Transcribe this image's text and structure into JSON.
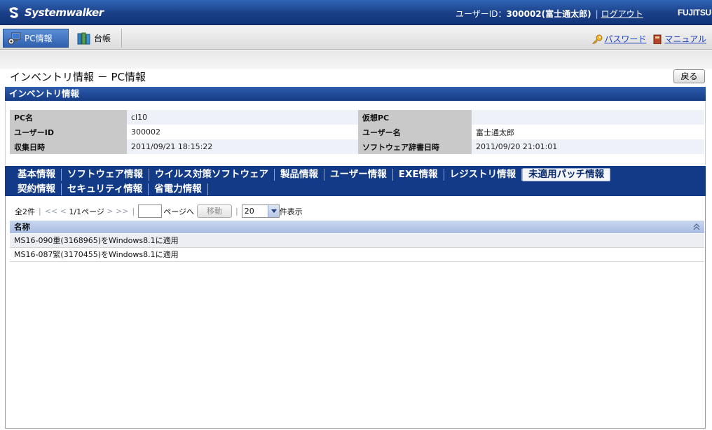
{
  "header": {
    "brand": "Systemwalker",
    "user_label": "ユーザーID：",
    "user_value": "300002(富士通太郎)",
    "separator": "|",
    "logout": "ログアウト",
    "company": "FUJITSU"
  },
  "toolbar": {
    "tabs": [
      {
        "label": "PC情報",
        "icon": "pc-icon",
        "active": true
      },
      {
        "label": "台帳",
        "icon": "ledger-books-icon",
        "active": false
      }
    ],
    "password": "パスワード",
    "manual": "マニュアル"
  },
  "page": {
    "title": "インベントリ情報 － PC情報",
    "back_button": "戻る"
  },
  "inventory": {
    "section_title": "インベントリ情報",
    "rows": [
      {
        "label1": "PC名",
        "value1": "cl10",
        "label2": "仮想PC",
        "value2": ""
      },
      {
        "label1": "ユーザーID",
        "value1": "300002",
        "label2": "ユーザー名",
        "value2": "富士通太郎"
      },
      {
        "label1": "収集日時",
        "value1": "2011/09/21 18:15:22",
        "label2": "ソフトウェア辞書日時",
        "value2": "2011/09/20 21:01:01"
      }
    ]
  },
  "tabs": {
    "row1": [
      "基本情報",
      "ソフトウェア情報",
      "ウイルス対策ソフトウェア",
      "製品情報",
      "ユーザー情報",
      "EXE情報",
      "レジストリ情報",
      "未適用パッチ情報"
    ],
    "row2": [
      "契約情報",
      "セキュリティ情報",
      "省電力情報"
    ],
    "active": "未適用パッチ情報"
  },
  "pager": {
    "total": "全2件",
    "first": "<<",
    "prev": "<",
    "page_info": "1/1ページ",
    "next": ">",
    "last": ">>",
    "page_input": "",
    "goto_label": "ページへ",
    "move_button": "移動",
    "page_size": "20",
    "page_size_suffix": "件表示"
  },
  "list": {
    "column": "名称",
    "items": [
      "MS16-090重(3168965)をWindows8.1に適用",
      "MS16-087緊(3170455)をWindows8.1に適用"
    ]
  },
  "colors": {
    "header_blue": "#1a3f86",
    "tab_blue": "#123a86",
    "active_tab_bg": "#f4f6fb"
  }
}
